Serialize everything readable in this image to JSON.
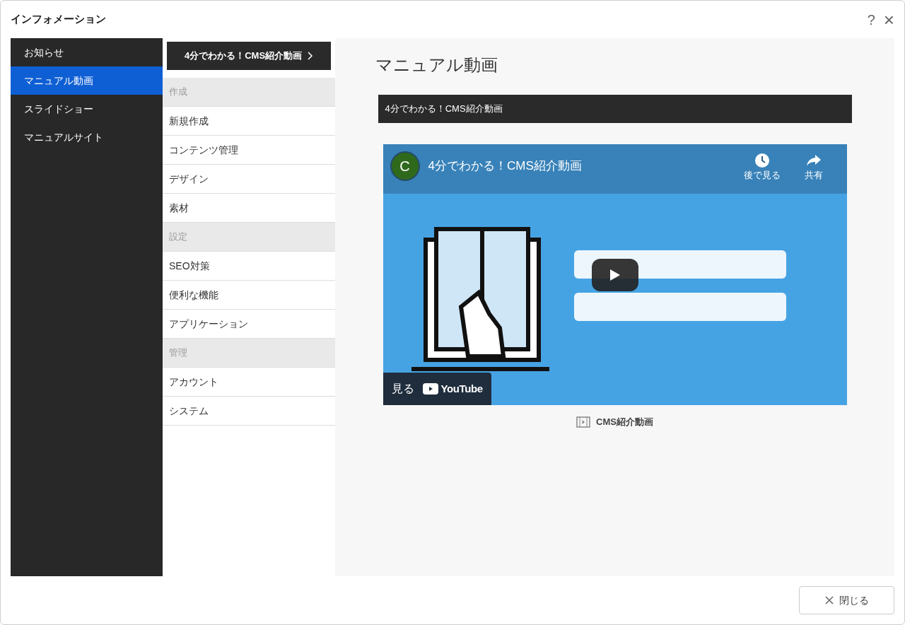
{
  "window": {
    "title": "インフォメーション",
    "help": "?",
    "close": "×"
  },
  "sidebar": {
    "items": [
      {
        "label": "お知らせ",
        "selected": false
      },
      {
        "label": "マニュアル動画",
        "selected": true
      },
      {
        "label": "スライドショー",
        "selected": false
      },
      {
        "label": "マニュアルサイト",
        "selected": false
      }
    ]
  },
  "middle": {
    "top_button": "4分でわかる！CMS紹介動画",
    "items": [
      {
        "kind": "header",
        "label": "作成"
      },
      {
        "kind": "link",
        "label": "新規作成"
      },
      {
        "kind": "link",
        "label": "コンテンツ管理"
      },
      {
        "kind": "link",
        "label": "デザイン"
      },
      {
        "kind": "link",
        "label": "素材"
      },
      {
        "kind": "header",
        "label": "設定"
      },
      {
        "kind": "link",
        "label": "SEO対策"
      },
      {
        "kind": "link",
        "label": "便利な機能"
      },
      {
        "kind": "link",
        "label": "アプリケーション"
      },
      {
        "kind": "header",
        "label": "管理"
      },
      {
        "kind": "link",
        "label": "アカウント"
      },
      {
        "kind": "link",
        "label": "システム"
      }
    ]
  },
  "content": {
    "heading": "マニュアル動画",
    "bar_title": "4分でわかる！CMS紹介動画",
    "player": {
      "channel_initial": "C",
      "title": "4分でわかる！CMS紹介動画",
      "watch_later": "後で見る",
      "share": "共有",
      "watch_on": "見る",
      "logo_text": "YouTube"
    },
    "caption": "CMS紹介動画"
  },
  "footer": {
    "close_button": "閉じる"
  }
}
